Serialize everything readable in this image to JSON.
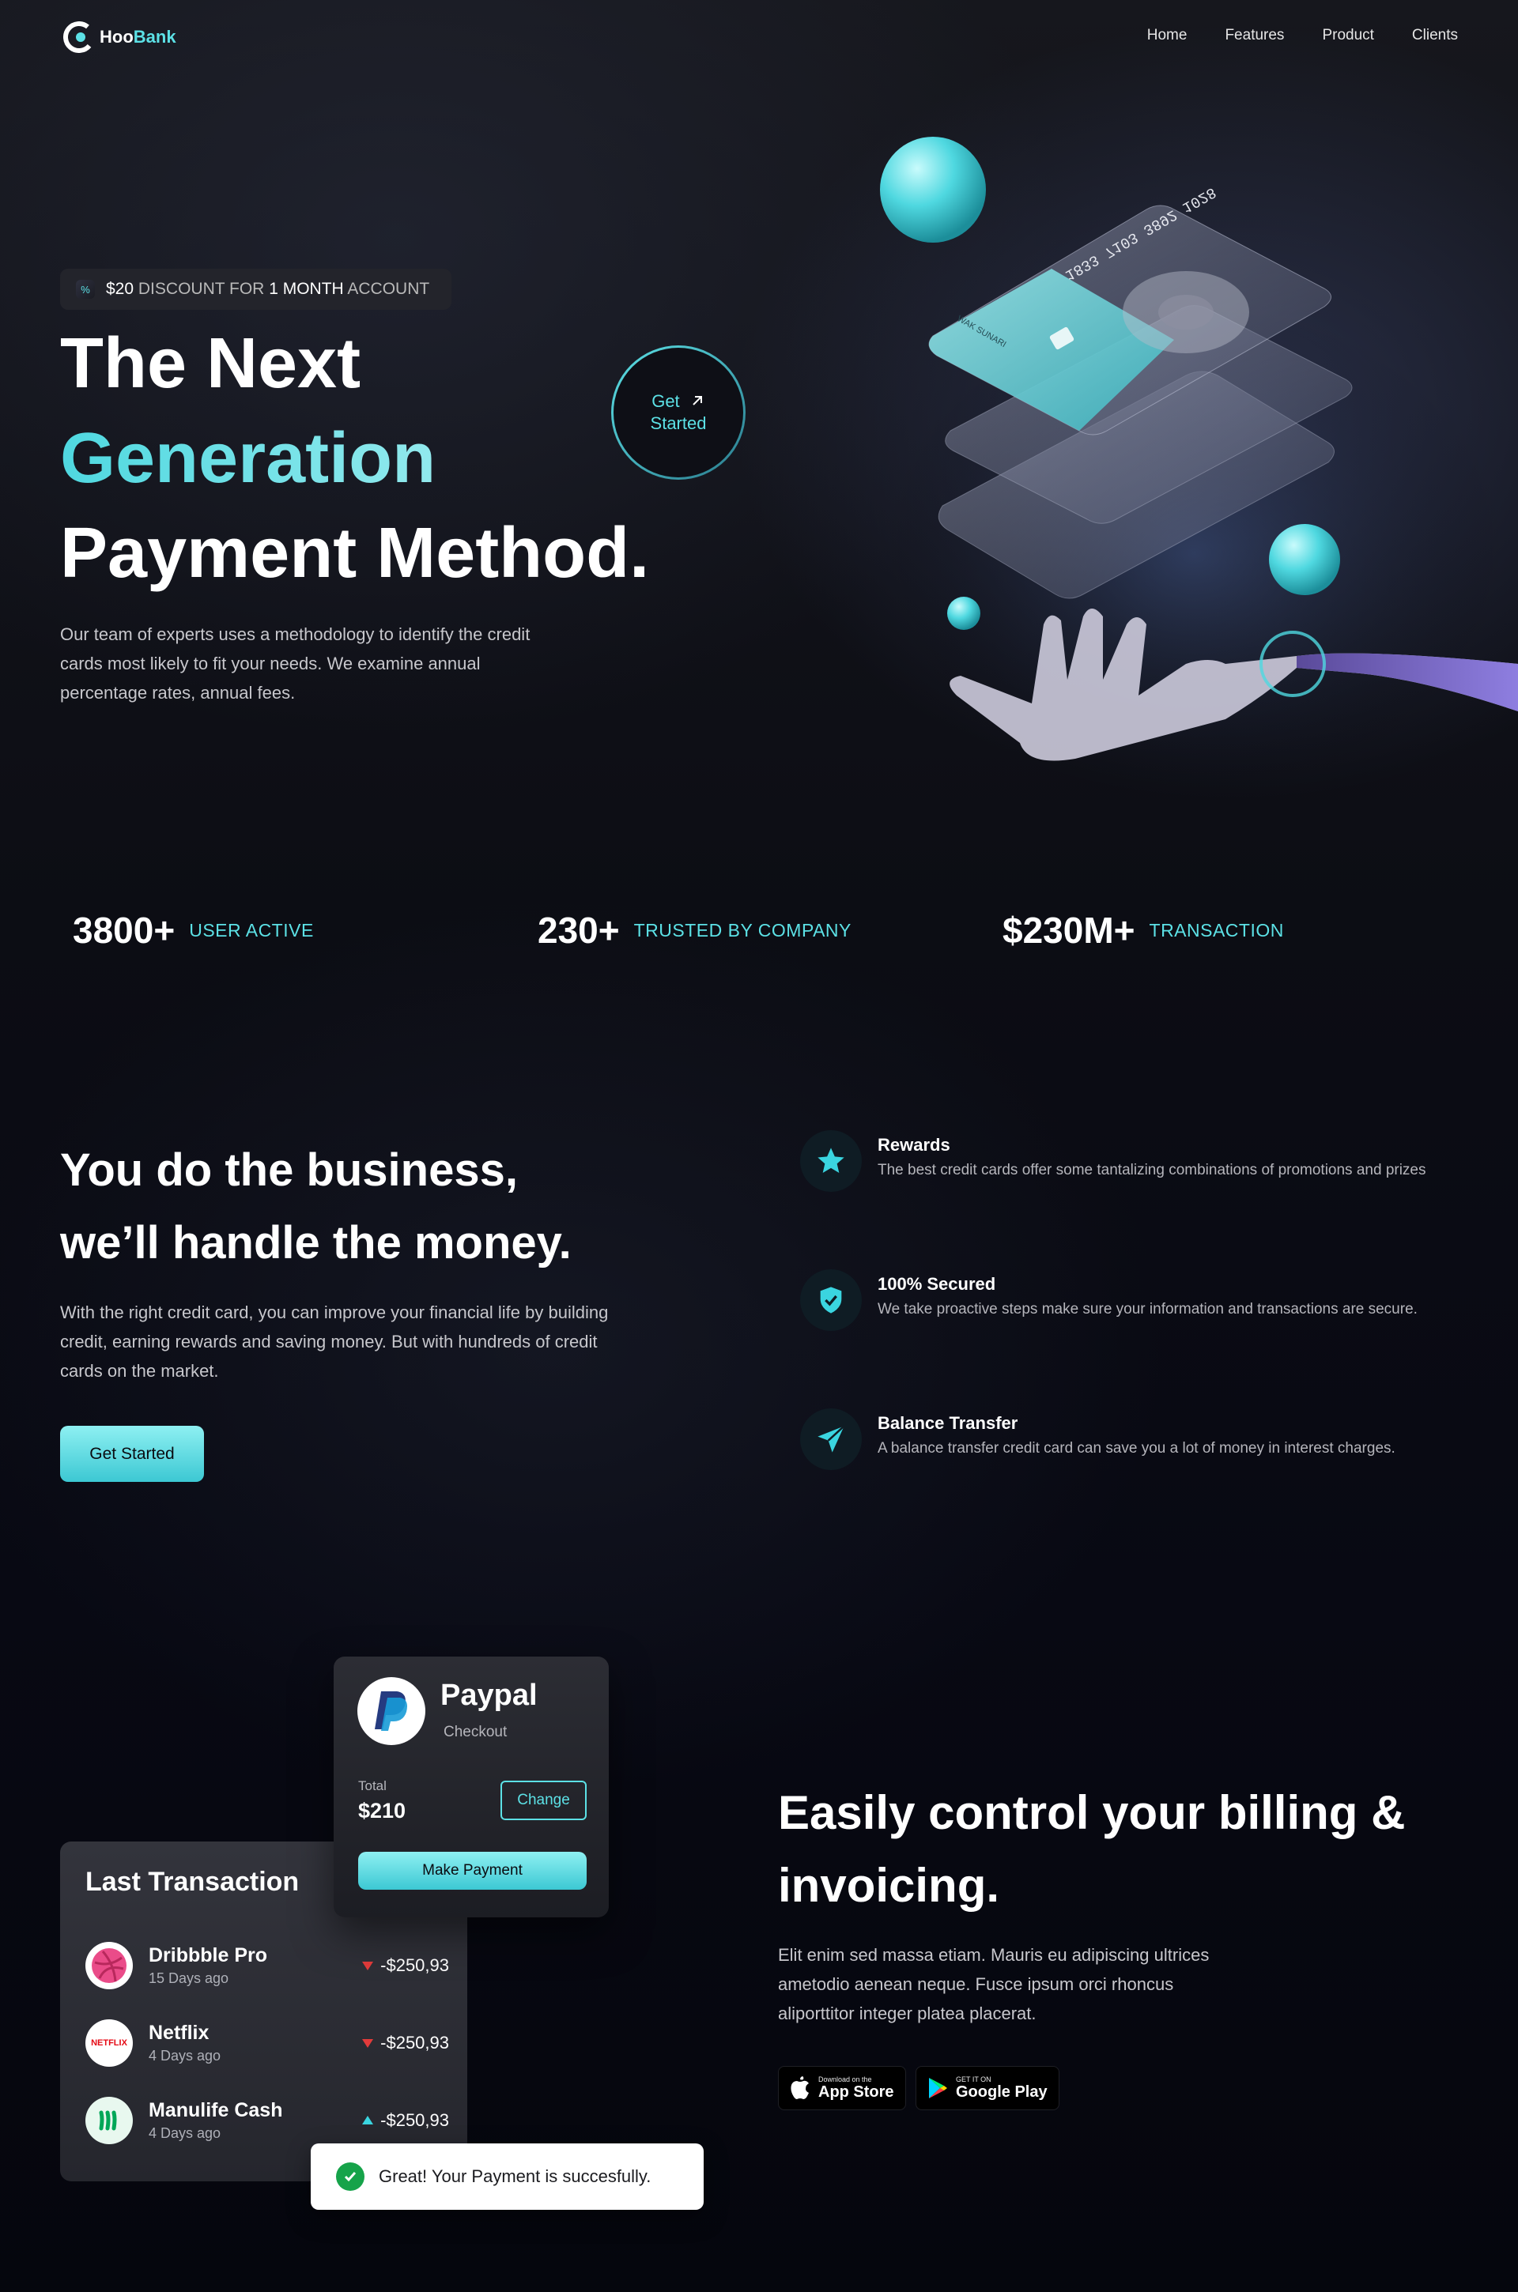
{
  "brand": {
    "name_part1": "Hoo",
    "name_part2": "Bank",
    "accent_color": "#5ce1e6"
  },
  "nav": {
    "items": [
      {
        "label": "Home"
      },
      {
        "label": "Features"
      },
      {
        "label": "Product"
      },
      {
        "label": "Clients"
      }
    ]
  },
  "hero": {
    "discount": {
      "amount": "$20",
      "text1": "DISCOUNT FOR",
      "highlight": "1 MONTH",
      "text2": "ACCOUNT",
      "icon": "discount-icon"
    },
    "title_line1": "The Next",
    "title_line2": "Generation",
    "title_line3": "Payment Method.",
    "description": "Our team of experts uses a methodology to identify the credit cards most likely to fit your needs. We examine annual percentage rates, annual fees.",
    "cta_line1": "Get",
    "cta_line2": "Started",
    "cta_icon": "arrow-up-right-icon",
    "card_number": "1833 7103 3892 1028",
    "card_holder": "WAK SUNARI"
  },
  "stats": [
    {
      "value": "3800+",
      "label": "USER ACTIVE"
    },
    {
      "value": "230+",
      "label": "TRUSTED BY COMPANY"
    },
    {
      "value": "$230M+",
      "label": "TRANSACTION"
    }
  ],
  "business": {
    "title_line1": "You do the business,",
    "title_line2": "we’ll handle the money.",
    "description": "With the right credit card, you can improve your financial life by building credit, earning rewards and saving money. But with hundreds of credit cards on the market.",
    "button": "Get Started",
    "features": [
      {
        "icon": "star-icon",
        "title": "Rewards",
        "description": "The best credit cards offer some tantalizing combinations of promotions and prizes"
      },
      {
        "icon": "shield-icon",
        "title": "100% Secured",
        "description": "We take proactive steps make sure your information and transactions are secure."
      },
      {
        "icon": "send-icon",
        "title": "Balance Transfer",
        "description": "A balance transfer credit card can save you a lot of money in interest charges."
      }
    ]
  },
  "billing": {
    "paypal": {
      "name": "Paypal",
      "subtitle": "Checkout",
      "total_label": "Total",
      "total": "$210",
      "change_button": "Change",
      "pay_button": "Make Payment"
    },
    "transactions": {
      "title": "Last Transaction",
      "items": [
        {
          "name": "Dribbble Pro",
          "date": "15 Days ago",
          "amount": "-$250,93",
          "direction": "down",
          "icon": "dribbble-icon"
        },
        {
          "name": "Netflix",
          "date": "4 Days ago",
          "amount": "-$250,93",
          "direction": "down",
          "icon": "netflix-icon",
          "logo_text": "NETFLIX"
        },
        {
          "name": "Manulife Cash",
          "date": "4 Days ago",
          "amount": "-$250,93",
          "direction": "up",
          "icon": "manulife-icon"
        }
      ]
    },
    "toast": "Great! Your Payment is succesfully.",
    "title_line1": "Easily control your billing &",
    "title_line2": "invoicing.",
    "description": "Elit enim sed massa etiam. Mauris eu adipiscing ultrices ametodio aenean neque. Fusce ipsum orci rhoncus aliporttitor integer platea placerat.",
    "app_store": {
      "small": "Download on the",
      "big": "App Store",
      "icon": "apple-icon"
    },
    "google_play": {
      "small": "GET IT ON",
      "big": "Google Play",
      "icon": "google-play-icon"
    }
  }
}
